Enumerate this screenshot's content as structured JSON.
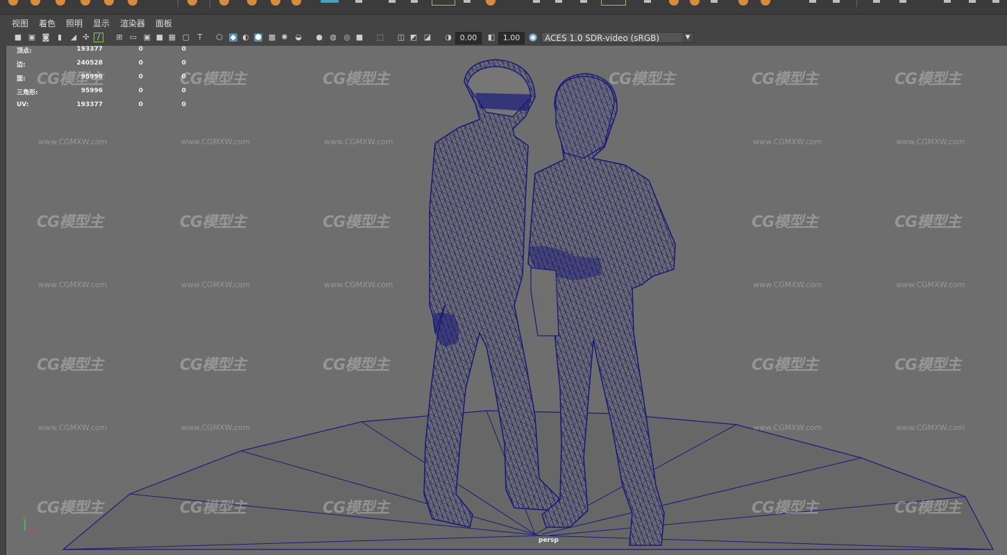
{
  "menu": [
    "视图",
    "着色",
    "照明",
    "显示",
    "渲染器",
    "面板"
  ],
  "toolbar": {
    "exposure_value": "0.00",
    "gamma_value": "1.00",
    "color_space": "ACES 1.0 SDR-video (sRGB)"
  },
  "hud": [
    {
      "label": "顶点:",
      "v1": "193377",
      "v2": "0",
      "v3": "0"
    },
    {
      "label": "边:",
      "v1": "240528",
      "v2": "0",
      "v3": "0"
    },
    {
      "label": "面:",
      "v1": "95996",
      "v2": "0",
      "v3": "0"
    },
    {
      "label": "三角形:",
      "v1": "95996",
      "v2": "0",
      "v3": "0"
    },
    {
      "label": "UV:",
      "v1": "193377",
      "v2": "0",
      "v3": "0"
    }
  ],
  "viewport": {
    "camera": "persp",
    "wireframe_color": "#1a1a7a",
    "background_color": "#6e6e6e"
  },
  "watermark": {
    "logo": "CG模型主",
    "url": "www.CGMXW.com"
  },
  "axis": {
    "y": "y",
    "x": "x"
  }
}
